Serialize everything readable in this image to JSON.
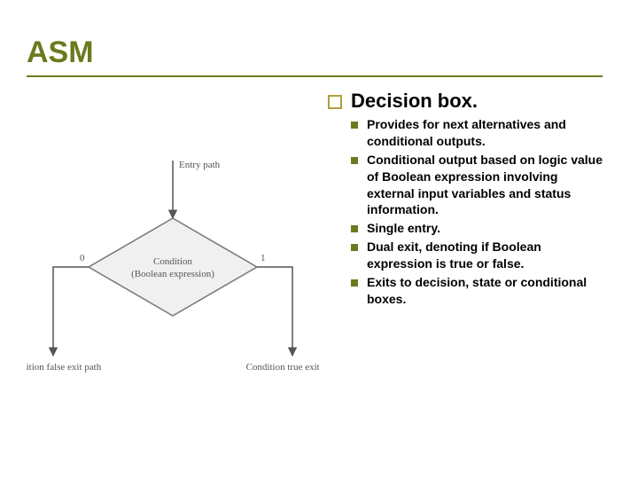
{
  "title": "ASM",
  "heading": "Decision box.",
  "items": [
    "Provides for next alternatives and conditional outputs.",
    "Conditional output based on logic value of Boolean expression involving external input variables and status information.",
    "Single entry.",
    "Dual exit, denoting if Boolean expression is true or false.",
    "Exits to decision, state or conditional boxes."
  ],
  "figure": {
    "entry": "Entry path",
    "condition_line1": "Condition",
    "condition_line2": "(Boolean expression)",
    "left_branch": "0",
    "right_branch": "1",
    "left_exit": "Condition false exit path",
    "right_exit": "Condition true exit path"
  }
}
